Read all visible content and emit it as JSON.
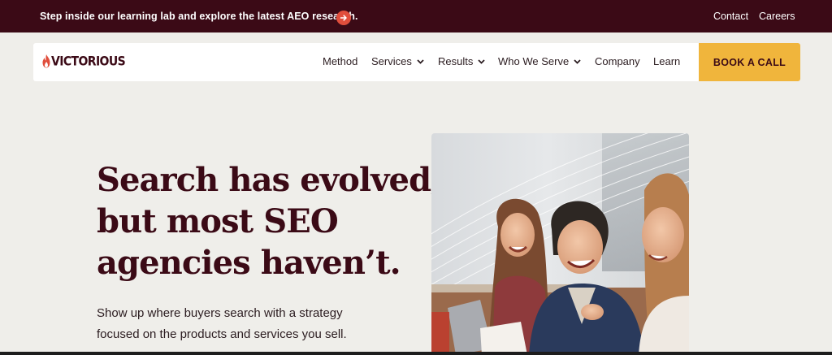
{
  "announcement": {
    "text": "Step inside our learning lab and explore the latest AEO research.",
    "arrow_icon": "arrow-right-icon"
  },
  "utility_nav": {
    "contact": "Contact",
    "careers": "Careers"
  },
  "brand": {
    "logo_text": "VICTORIOUS",
    "logo_icon": "flame-icon"
  },
  "nav": {
    "method": "Method",
    "services": "Services",
    "results": "Results",
    "who_we_serve": "Who We Serve",
    "company": "Company",
    "learn": "Learn",
    "cta": "BOOK A CALL"
  },
  "hero": {
    "title_line1": "Search has evolved,",
    "title_line2": "but most SEO",
    "title_line3": "agencies haven’t.",
    "subtitle_line1": "Show up where buyers search with a strategy",
    "subtitle_line2": "focused on the products and services you sell."
  },
  "colors": {
    "maroon": "#3b0a16",
    "accent_red": "#e04e3c",
    "cta_yellow": "#f0b53c",
    "page_bg": "#efeeea"
  }
}
